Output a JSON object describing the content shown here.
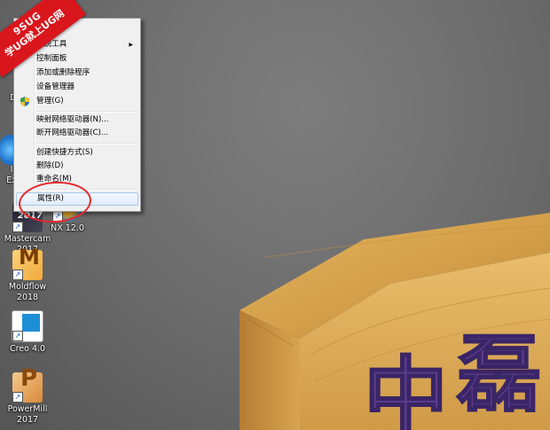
{
  "watermark": {
    "line1": "9SUG",
    "line2": "学UG就上UG网"
  },
  "desktop_icons": [
    {
      "id": "ie",
      "label": "I\nEx"
    },
    {
      "id": "mastercam",
      "label": "Mastercam\n2017",
      "img_text": "2017"
    },
    {
      "id": "nx",
      "label": "NX 12.0"
    },
    {
      "id": "moldflow",
      "label": "Moldflow\n2018",
      "img_text": "M"
    },
    {
      "id": "creo",
      "label": "Creo 4.0"
    },
    {
      "id": "powermill",
      "label": "PowerMill\n2017",
      "img_text": "P"
    }
  ],
  "context_menu": {
    "items": [
      {
        "label": "(O)",
        "bold": true
      },
      {
        "label": "系统工具",
        "submenu": true
      },
      {
        "label": "控制面板"
      },
      {
        "label": "添加或删除程序"
      },
      {
        "label": "设备管理器"
      },
      {
        "label": "管理(G)",
        "icon": "shield-icon"
      },
      {
        "label": "映射网络驱动器(N)..."
      },
      {
        "label": "断开网络驱动器(C)..."
      },
      {
        "label": "创建快捷方式(S)"
      },
      {
        "label": "删除(D)"
      },
      {
        "label": "重命名(M)"
      },
      {
        "label": "属性(R)",
        "highlighted": true
      }
    ],
    "submenu_arrow": "▶"
  },
  "sign": {
    "chars": [
      "中",
      "磊"
    ],
    "wood_color": "#c9953e",
    "text_color": "#5b3b8c"
  },
  "annotation_color": "#e8262b"
}
